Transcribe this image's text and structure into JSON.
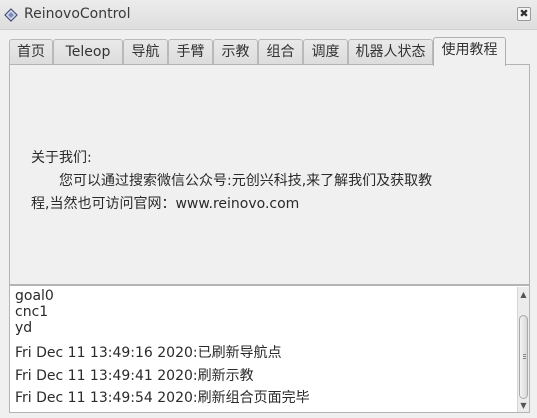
{
  "window": {
    "title": "ReinovoControl",
    "close_glyph": "✖",
    "icon": "diamond-app-icon"
  },
  "tabs": [
    {
      "label": "首页",
      "active": false
    },
    {
      "label": "Teleop",
      "active": false
    },
    {
      "label": "导航",
      "active": false
    },
    {
      "label": "手臂",
      "active": false
    },
    {
      "label": "示教",
      "active": false
    },
    {
      "label": "组合",
      "active": false
    },
    {
      "label": "调度",
      "active": false
    },
    {
      "label": "机器人状态",
      "active": false
    },
    {
      "label": "使用教程",
      "active": true
    }
  ],
  "about": {
    "title": "关于我们:",
    "line1": "您可以通过搜索微信公众号:元创兴科技,来了解我们及获取教",
    "line2": "程,当然也可访问官网：www.reinovo.com"
  },
  "log": {
    "lines": [
      "goal0",
      "cnc1",
      "yd",
      "Fri Dec 11 13:49:16 2020:已刷新导航点",
      "Fri Dec 11 13:49:41 2020:刷新示教",
      "Fri Dec 11 13:49:54 2020:刷新组合页面完毕"
    ],
    "scroll_up_glyph": "▲",
    "scroll_down_glyph": "▼"
  }
}
